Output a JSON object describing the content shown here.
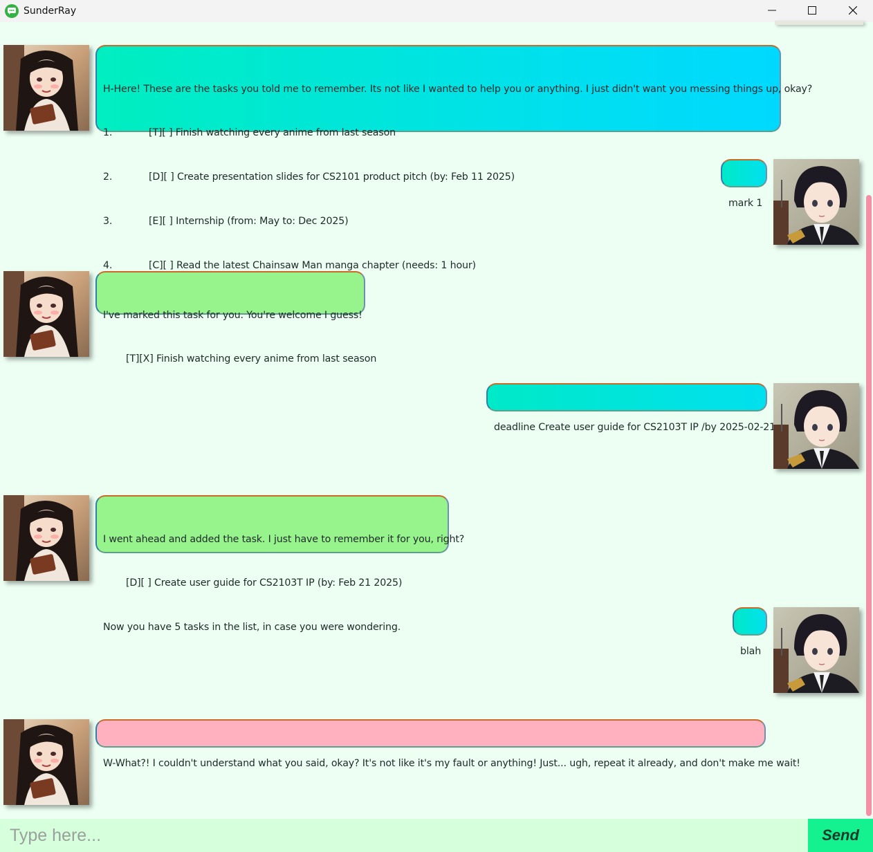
{
  "window": {
    "title": "SunderRay",
    "minimize_icon": "minimize-icon",
    "maximize_icon": "maximize-icon",
    "close_icon": "close-icon"
  },
  "messages": [
    {
      "sender": "bot",
      "mood": "cyan",
      "lines": [
        {
          "num": "",
          "text": "H-Here! These are the tasks you told me to remember. Its not like I wanted to help you or anything. I just didn't want you messing things up, okay?"
        },
        {
          "num": "1.",
          "text": "[T][ ] Finish watching every anime from last season"
        },
        {
          "num": "2.",
          "text": "[D][ ] Create presentation slides for CS2101 product pitch (by: Feb 11 2025)"
        },
        {
          "num": "3.",
          "text": "[E][ ] Internship (from: May to: Dec 2025)"
        },
        {
          "num": "4.",
          "text": "[C][ ] Read the latest Chainsaw Man manga chapter (needs: 1 hour)"
        }
      ]
    },
    {
      "sender": "user",
      "text": "mark 1"
    },
    {
      "sender": "bot",
      "mood": "green",
      "lines": [
        {
          "indent": false,
          "text": "I've marked this task for you. You're welcome I guess!"
        },
        {
          "indent": true,
          "text": "[T][X] Finish watching every anime from last season"
        }
      ]
    },
    {
      "sender": "user",
      "text": "deadline Create user guide for CS2103T IP /by 2025-02-21"
    },
    {
      "sender": "bot",
      "mood": "green",
      "lines": [
        {
          "indent": false,
          "text": "I went ahead and added the task. I just have to remember it for you, right?"
        },
        {
          "indent": true,
          "text": "[D][ ] Create user guide for CS2103T IP (by: Feb 21 2025)"
        },
        {
          "indent": false,
          "text": "Now you have 5 tasks in the list, in case you were wondering."
        }
      ]
    },
    {
      "sender": "user",
      "text": "blah"
    },
    {
      "sender": "bot",
      "mood": "pink",
      "lines": [
        {
          "indent": false,
          "text": "W-What?! I couldn't understand what you said, okay? It's not like it's my fault or anything! Just... ugh, repeat it already, and don't make me wait!"
        }
      ]
    }
  ],
  "avatars": {
    "bot": "girl-avatar",
    "user": "boy-avatar"
  },
  "input": {
    "placeholder": "Type here...",
    "value": ""
  },
  "send_button": {
    "label": "Send"
  },
  "colors": {
    "background": "#edfff3",
    "bot_list_bubble": "#00dff0",
    "bot_success_bubble": "#97f38c",
    "bot_error_bubble": "#ffb1bf",
    "user_bubble": "#00e5e0",
    "scrollbar": "#f58fa8",
    "send_button": "#13f28f",
    "input_bg": "#d6ffdc"
  }
}
